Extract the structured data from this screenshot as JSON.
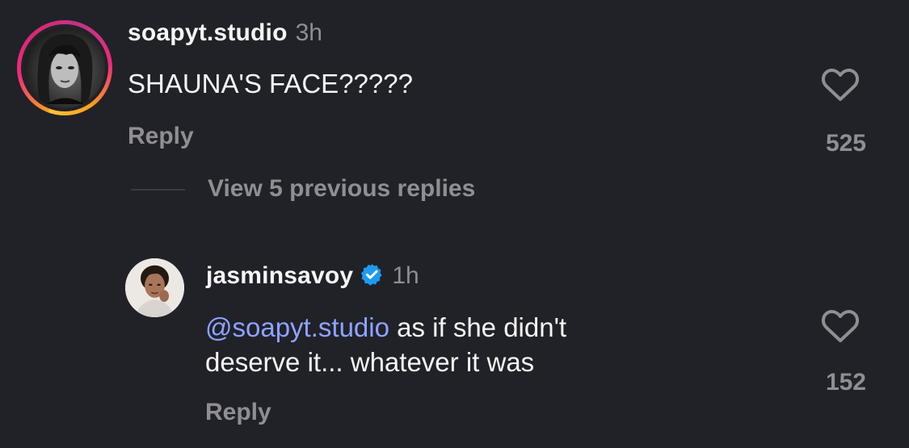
{
  "comment": {
    "username": "soapyt.studio",
    "time": "3h",
    "text": "SHAUNA'S FACE?????",
    "reply_label": "Reply",
    "likes": "525"
  },
  "view_replies": "View 5 previous replies",
  "reply": {
    "username": "jasminsavoy",
    "verified": true,
    "time": "1h",
    "mention": "@soapyt.studio",
    "text_line1": " as if she didn't",
    "text_line2": "deserve it... whatever it was",
    "reply_label": "Reply",
    "likes": "152"
  },
  "colors": {
    "background": "#212227",
    "text_primary": "#f5f5f5",
    "text_secondary": "#8e8e93",
    "mention": "#8ea3ff",
    "verified_badge": "#1d9bf0"
  },
  "icons": {
    "like": "heart-outline-icon",
    "verified": "verified-badge-icon"
  }
}
